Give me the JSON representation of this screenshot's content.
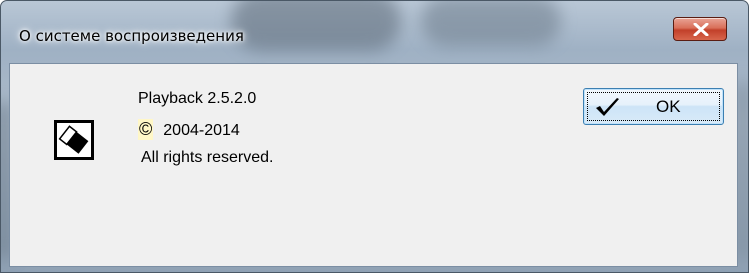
{
  "window": {
    "title": "О системе воспроизведения",
    "close_glyph": "x"
  },
  "about": {
    "app_icon": "playback-app-icon",
    "version": "Playback 2.5.2.0",
    "copyright_symbol": "©",
    "copyright_years": "2004-2014",
    "rights": "All rights reserved."
  },
  "buttons": {
    "ok_label": "OK",
    "ok_icon": "checkmark-icon"
  },
  "colors": {
    "close_button": "#c2402a",
    "client_background": "#f0f0f0",
    "ok_border": "#3c7fb1"
  }
}
